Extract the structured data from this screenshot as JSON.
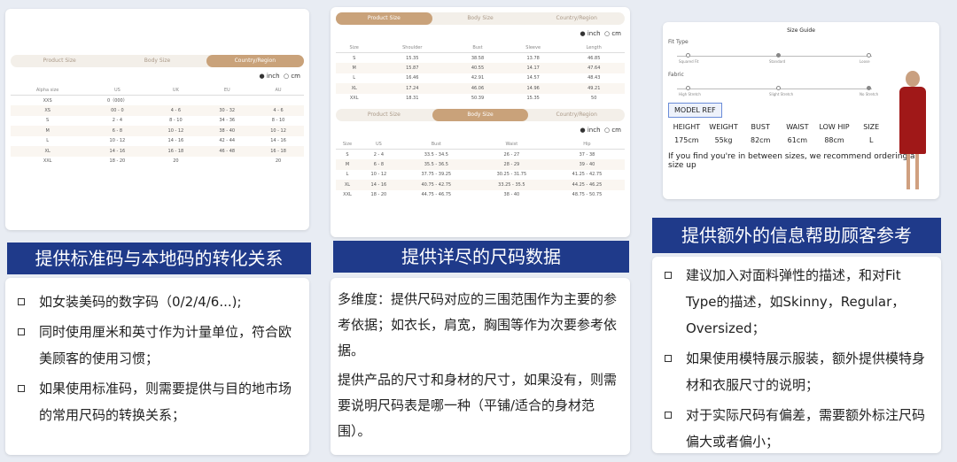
{
  "left": {
    "tabs": [
      "Product Size",
      "Body Size",
      "Country/Region"
    ],
    "unit_inch": "inch",
    "unit_cm": "cm",
    "headers": [
      "Alpha size",
      "US",
      "UK",
      "EU",
      "AU"
    ],
    "rows": [
      [
        "XXS",
        "0（000）",
        "",
        "",
        ""
      ],
      [
        "XS",
        "00 - 0",
        "4 - 6",
        "30 - 32",
        "4 - 6"
      ],
      [
        "S",
        "2 - 4",
        "8 - 10",
        "34 - 36",
        "8 - 10"
      ],
      [
        "M",
        "6 - 8",
        "10 - 12",
        "38 - 40",
        "10 - 12"
      ],
      [
        "L",
        "10 - 12",
        "14 - 16",
        "42 - 44",
        "14 - 16"
      ],
      [
        "XL",
        "14 - 16",
        "16 - 18",
        "46 - 48",
        "16 - 18"
      ],
      [
        "XXL",
        "18 - 20",
        "20",
        "",
        "20"
      ]
    ],
    "banner": "提供标准码与本地码的转化关系",
    "bullets": [
      "如女装美码的数字码（0/2/4/6...);",
      "同时使用厘米和英寸作为计量单位，符合欧美顾客的使用习惯；",
      "如果使用标准码，则需要提供与目的地市场的常用尺码的转换关系；"
    ]
  },
  "mid": {
    "tabs": [
      "Product Size",
      "Body Size",
      "Country/Region"
    ],
    "unit_inch": "inch",
    "unit_cm": "cm",
    "h1": [
      "Size",
      "Shoulder",
      "Bust",
      "Sleeve",
      "Length"
    ],
    "r1": [
      [
        "S",
        "15.35",
        "38.58",
        "13.78",
        "46.85"
      ],
      [
        "M",
        "15.87",
        "40.55",
        "14.17",
        "47.64"
      ],
      [
        "L",
        "16.46",
        "42.91",
        "14.57",
        "48.43"
      ],
      [
        "XL",
        "17.24",
        "46.06",
        "14.96",
        "49.21"
      ],
      [
        "XXL",
        "18.31",
        "50.39",
        "15.35",
        "50"
      ]
    ],
    "h2": [
      "Size",
      "US",
      "Bust",
      "Waist",
      "Hip"
    ],
    "r2": [
      [
        "S",
        "2 - 4",
        "33.5 - 34.5",
        "26 - 27",
        "37 - 38"
      ],
      [
        "M",
        "6 - 8",
        "35.5 - 36.5",
        "28 - 29",
        "39 - 40"
      ],
      [
        "L",
        "10 - 12",
        "37.75 - 39.25",
        "30.25 - 31.75",
        "41.25 - 42.75"
      ],
      [
        "XL",
        "14 - 16",
        "40.75 - 42.75",
        "33.25 - 35.5",
        "44.25 - 46.25"
      ],
      [
        "XXL",
        "18 - 20",
        "44.75 - 46.75",
        "38 - 40",
        "48.75 - 50.75"
      ]
    ],
    "banner": "提供详尽的尺码数据",
    "p1": "多维度：提供尺码对应的三围范围作为主要的参考依据；如衣长，肩宽，胸围等作为次要参考依据。",
    "p2": "提供产品的尺寸和身材的尺寸，如果没有，则需要说明尺码表是哪一种（平铺/适合的身材范围）。"
  },
  "right": {
    "title": "Size Guide",
    "fit": "Fit Type",
    "fit_opts": [
      "Squared Fit",
      "Standard",
      "Loose"
    ],
    "fabric": "Fabric",
    "fab_opts": [
      "High Stretch",
      "Slight Stretch",
      "No Stretch"
    ],
    "model_ref": "MODEL REF",
    "mh": [
      "HEIGHT",
      "WEIGHT",
      "BUST",
      "WAIST",
      "LOW HIP",
      "SIZE"
    ],
    "mv": [
      "175cm",
      "55kg",
      "82cm",
      "61cm",
      "88cm",
      "L"
    ],
    "note": "If you find you're in between sizes, we recommend ordering a size up",
    "banner": "提供额外的信息帮助顾客参考",
    "bullets": [
      "建议加入对面料弹性的描述，和对Fit Type的描述，如Skinny，Regular，Oversized；",
      "如果使用模特展示服装，额外提供模特身材和衣服尺寸的说明；",
      "对于实际尺码有偏差，需要额外标注尺码偏大或者偏小；"
    ]
  }
}
